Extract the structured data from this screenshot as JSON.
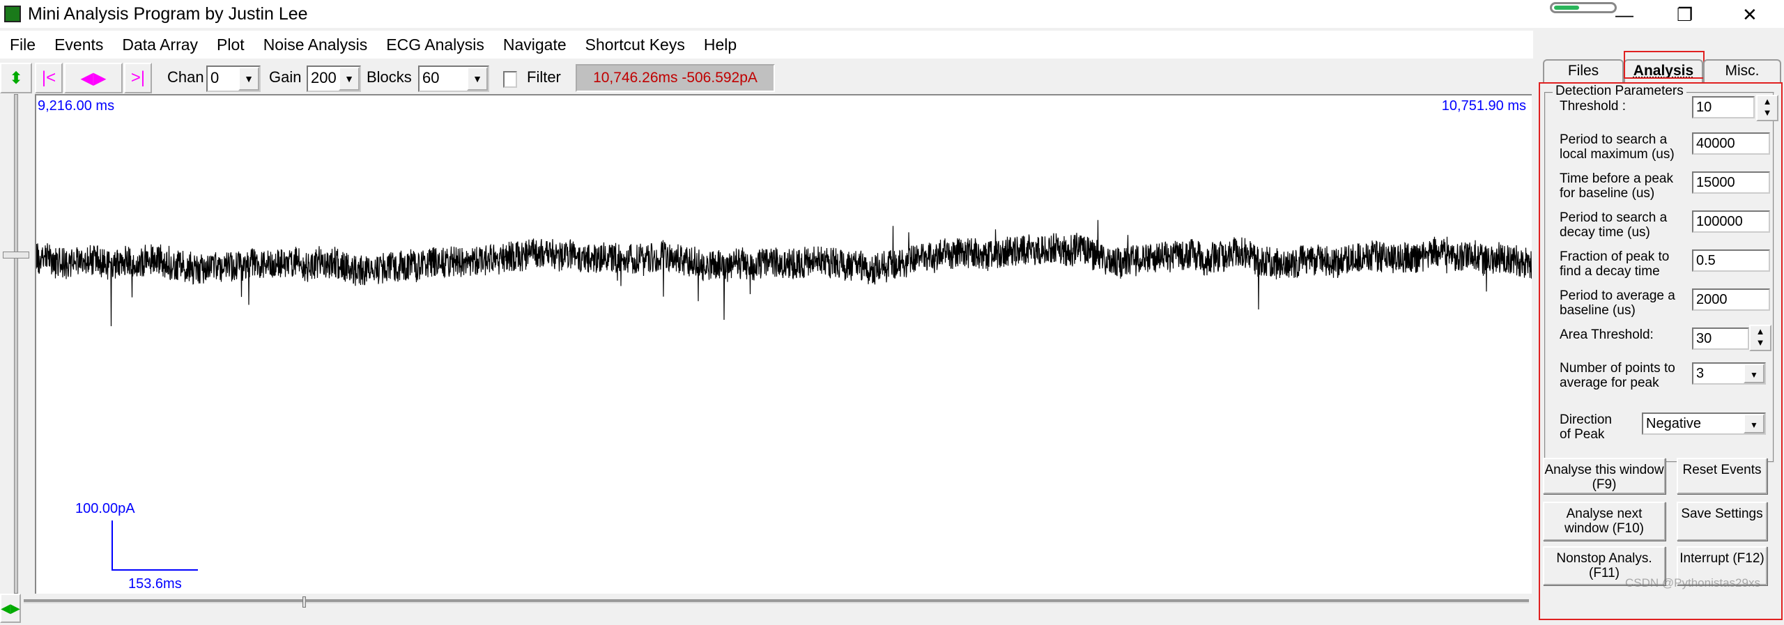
{
  "window": {
    "title": "Mini Analysis Program by Justin Lee",
    "minimize": "—",
    "restore": "❐",
    "close": "✕"
  },
  "menu": [
    "File",
    "Events",
    "Data Array",
    "Plot",
    "Noise Analysis",
    "ECG Analysis",
    "Navigate",
    "Shortcut Keys",
    "Help"
  ],
  "toolbar": {
    "first": "|<",
    "prevnext": "◀▶",
    "last": ">|",
    "chan_label": "Chan",
    "chan_value": "0",
    "gain_label": "Gain",
    "gain_value": "200",
    "blocks_label": "Blocks",
    "blocks_value": "60",
    "filter_label": "Filter",
    "filter_checked": false,
    "readout": "10,746.26ms  -506.592pA"
  },
  "plot": {
    "start_time": "9,216.00 ms",
    "end_time": "10,751.90 ms",
    "scale_y": "100.00pA",
    "scale_x": "153.6ms",
    "trace_color": "#000000",
    "scale_color": "#0000ff"
  },
  "panel": {
    "tabs": [
      "Files",
      "Analysis",
      "Misc."
    ],
    "active_tab": "Analysis",
    "group": "Detection Parameters",
    "params": [
      {
        "label": "Threshold :",
        "value": "10"
      },
      {
        "label": "Period to search a local maximum (us)",
        "value": "40000"
      },
      {
        "label": "Time before a peak for baseline (us)",
        "value": "15000"
      },
      {
        "label": "Period to search a decay time (us)",
        "value": "100000"
      },
      {
        "label": "Fraction of peak to find a decay time",
        "value": "0.5"
      },
      {
        "label": "Period to average a baseline (us)",
        "value": "2000"
      },
      {
        "label": "Area Threshold:",
        "value": "30"
      },
      {
        "label": "Number of points to average for peak",
        "value": "3"
      },
      {
        "label": "Direction of Peak",
        "value": "Negative"
      }
    ],
    "buttons": [
      "Analyse this window (F9)",
      "Reset Events",
      "Analyse next window (F10)",
      "Save Settings",
      "Nonstop Analys. (F11)",
      "Interrupt (F12)"
    ],
    "watermark": "CSDN @Pythonistas29xs"
  }
}
